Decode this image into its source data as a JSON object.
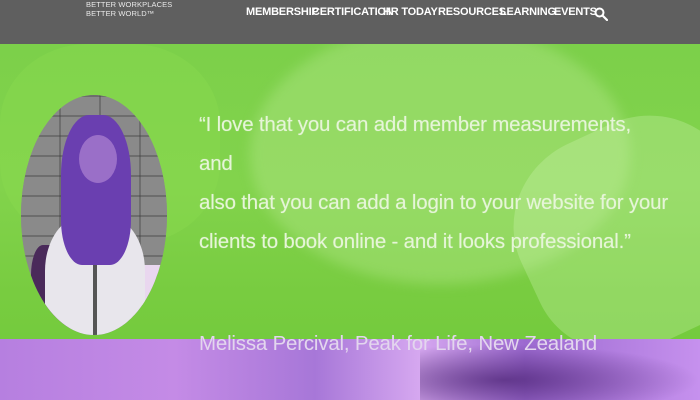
{
  "logo": {
    "line1": "BETTER WORKPLACES",
    "line2": "BETTER WORLD™"
  },
  "nav": {
    "items": [
      "MEMBERSHIP",
      "CERTIFICATION",
      "HR TODAY",
      "RESOURCES",
      "LEARNING",
      "EVENTS"
    ],
    "search_icon": "search-icon"
  },
  "testimonial": {
    "quote_line1": "“I love that you can add member measurements, and",
    "quote_line2": "also that you can add a login to your website for your",
    "quote_line3": "clients to book online - and it looks professional.”",
    "author": "Melissa Percival, Peak for Life, New Zealand"
  },
  "colors": {
    "topbar": "#5f5f5f",
    "hero_green": "#7ed443",
    "band_purple": "#b67fe0"
  }
}
